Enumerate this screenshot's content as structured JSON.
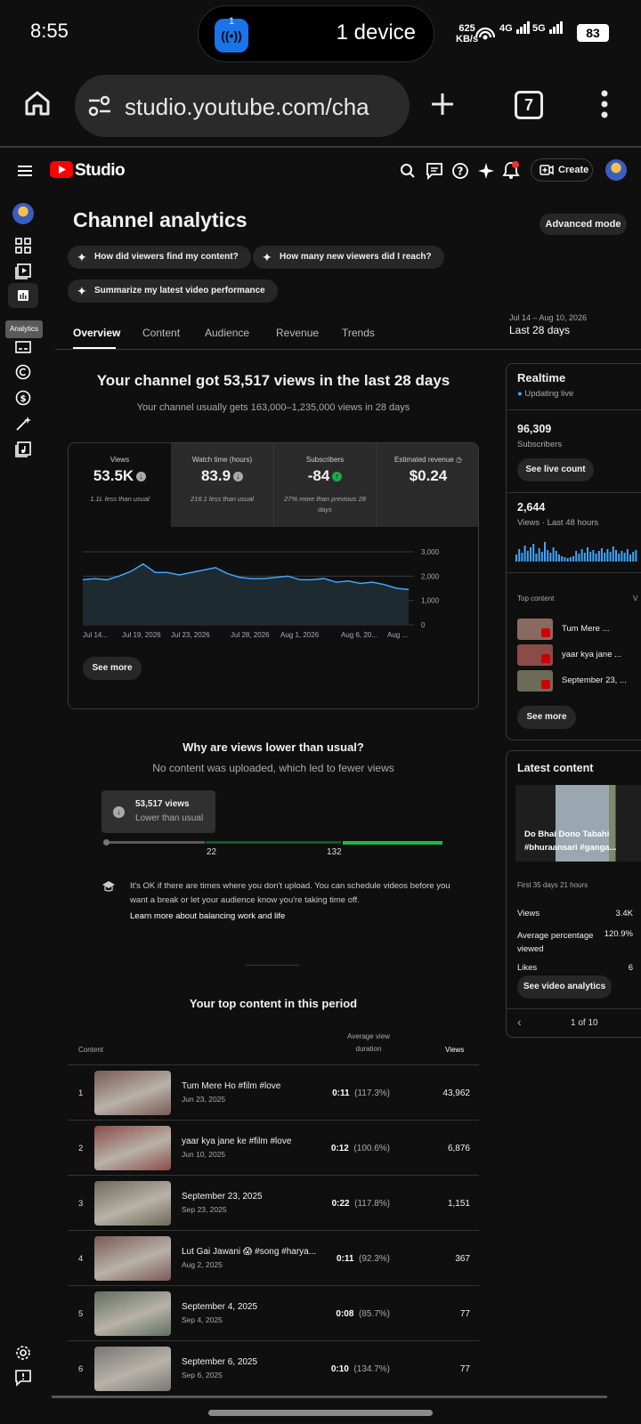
{
  "status_bar": {
    "time": "8:55",
    "pill_badge": "1",
    "pill_text": "1 device",
    "net_speed_value": "625",
    "net_speed_unit": "KB/s",
    "sig1": "4G",
    "sig2": "5G",
    "battery": "83"
  },
  "browser": {
    "url": "studio.youtube.com/cha",
    "tab_count": "7"
  },
  "studio": {
    "logo_text": "Studio",
    "create_label": "Create"
  },
  "left_rail": {
    "tooltip": "Analytics"
  },
  "page": {
    "title": "Channel analytics",
    "advanced_mode": "Advanced mode",
    "chips": [
      "How did viewers find my content?",
      "How many new viewers did I reach?",
      "Summarize my latest video performance"
    ],
    "tabs": [
      "Overview",
      "Content",
      "Audience",
      "Revenue",
      "Trends"
    ],
    "date_range": "Jul 14 – Aug 10, 2026",
    "date_label": "Last 28 days"
  },
  "overview": {
    "headline": "Your channel got 53,517 views in the last 28 days",
    "subline": "Your channel usually gets 163,000–1,235,000 views in 28 days",
    "metrics": [
      {
        "label": "Views",
        "value": "53.5K",
        "note": "1.1L less than usual",
        "trend": "down"
      },
      {
        "label": "Watch time (hours)",
        "value": "83.9",
        "note": "216.1 less than usual",
        "trend": "down"
      },
      {
        "label": "Subscribers",
        "value": "-84",
        "note": "27% more than previous 28 days",
        "trend": "up"
      },
      {
        "label": "Estimated revenue",
        "value": "$0.24",
        "note": "",
        "trend": "none"
      }
    ],
    "see_more": "See more"
  },
  "chart_data": {
    "type": "area",
    "series": [
      {
        "values": [
          1850,
          1900,
          1850,
          2000,
          2200,
          2500,
          2150,
          2150,
          2050,
          2150,
          2250,
          2350,
          2100,
          1950,
          1900,
          1900,
          1950,
          2000,
          1850,
          1850,
          1900,
          1750,
          1800,
          1700,
          1750,
          1650,
          1500,
          1450
        ]
      }
    ],
    "x_tick_labels": [
      "Jul 14...",
      "Jul 19, 2026",
      "Jul 23, 2026",
      "Jul 28, 2026",
      "Aug 1, 2026",
      "Aug 6, 20...",
      "Aug ..."
    ],
    "y_tick_labels": [
      "3,000",
      "2,000",
      "1,000",
      "0"
    ],
    "ylim": [
      0,
      3000
    ],
    "color": "#3ea6ff"
  },
  "why": {
    "title": "Why are views lower than usual?",
    "subtitle": "No content was uploaded, which led to fewer views",
    "box_value": "53,517 views",
    "box_label": "Lower than usual",
    "range_low": "22",
    "range_high": "132",
    "tip": "It's OK if there are times where you don't upload. You can schedule videos before you want a break or let your audience know you're taking time off.",
    "tip_link": "Learn more about balancing work and life"
  },
  "top_content": {
    "title": "Your top content in this period",
    "col_content": "Content",
    "col_avd_1": "Average view",
    "col_avd_2": "duration",
    "col_views": "Views",
    "rows": [
      {
        "rank": "1",
        "title": "Tum Mere Ho #film #love",
        "date": "Jun 23, 2025",
        "duration": "0:11",
        "pct": "(117.3%)",
        "views": "43,962",
        "thumb": "#7a5a55"
      },
      {
        "rank": "2",
        "title": "yaar kya jane ke #film #love",
        "date": "Jun 10, 2025",
        "duration": "0:12",
        "pct": "(100.6%)",
        "views": "6,876",
        "thumb": "#8a4c48"
      },
      {
        "rank": "3",
        "title": "September 23, 2025",
        "date": "Sep 23, 2025",
        "duration": "0:22",
        "pct": "(117.8%)",
        "views": "1,151",
        "thumb": "#6e6a58"
      },
      {
        "rank": "4",
        "title": "Lut Gai Jawani 😱 #song #harya...",
        "date": "Aug 2, 2025",
        "duration": "0:11",
        "pct": "(92.3%)",
        "views": "367",
        "thumb": "#7a5a56"
      },
      {
        "rank": "5",
        "title": "September 4, 2025",
        "date": "Sep 4, 2025",
        "duration": "0:08",
        "pct": "(85.7%)",
        "views": "77",
        "thumb": "#5f7060"
      },
      {
        "rank": "6",
        "title": "September 6, 2025",
        "date": "Sep 6, 2025",
        "duration": "0:10",
        "pct": "(134.7%)",
        "views": "77",
        "thumb": "#777777"
      }
    ]
  },
  "realtime": {
    "title": "Realtime",
    "updating": "Updating live",
    "subs": "96,309",
    "subs_label": "Subscribers",
    "see_live": "See live count",
    "views": "2,644",
    "views_label": "Views · Last 48 hours",
    "top_label": "Top content",
    "top_col2": "V",
    "items": [
      {
        "title": "Tum Mere ...",
        "val": "2,"
      },
      {
        "title": "yaar kya jane ...",
        "val": ""
      },
      {
        "title": "September 23, ...",
        "val": ""
      }
    ],
    "see_more": "See more"
  },
  "latest": {
    "title": "Latest content",
    "video_title": "Do Bhai Dono Tabahi #bhuraansari #ganga...",
    "first": "First 35 days 21 hours",
    "rows": [
      {
        "label": "Views",
        "value": "3.4K"
      },
      {
        "label": "Average percentage viewed",
        "value": "120.9%"
      },
      {
        "label": "Likes",
        "value": "6"
      }
    ],
    "btn": "See video analytics",
    "pager": "1 of 10"
  }
}
